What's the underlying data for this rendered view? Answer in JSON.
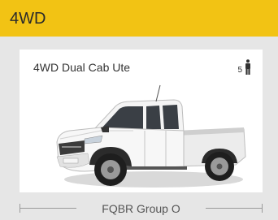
{
  "header": {
    "title": "4WD"
  },
  "vehicle": {
    "name": "4WD Dual Cab Ute",
    "seats": "5",
    "image_icon": "white-dual-cab-ute-image",
    "seat_icon": "person-icon"
  },
  "footer": {
    "group_label": "FQBR Group O"
  },
  "colors": {
    "header_bg": "#f2c314",
    "card_bg": "#e6e6e6",
    "panel_bg": "#ffffff"
  }
}
